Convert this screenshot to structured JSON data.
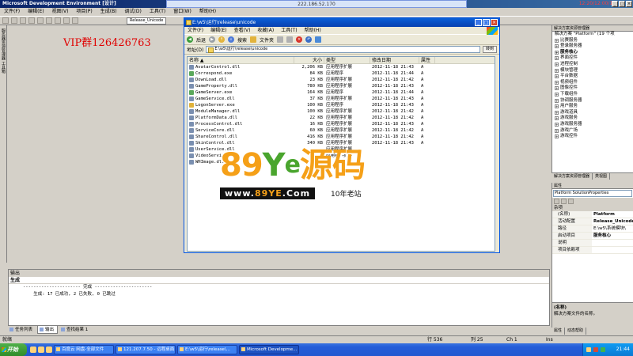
{
  "vs": {
    "title": "Microsoft Development Environment [设计]",
    "remote_ip": "222.186.52.170",
    "clock_top": "12:20/12:00/11",
    "menu": [
      "文件(F)",
      "编辑(E)",
      "视图(V)",
      "项目(P)",
      "生成(B)",
      "调试(D)",
      "工具(T)",
      "窗口(W)",
      "帮助(H)"
    ],
    "toolbar_combo": "Release_Unicode",
    "left_strip_label": "服务器资源管理器 工具箱"
  },
  "overlay_text": "VIP群126426763",
  "explorer": {
    "title": "E:\\w5\\运行\\release\\unicode",
    "menu": [
      "文件(F)",
      "编辑(E)",
      "查看(V)",
      "收藏(A)",
      "工具(T)",
      "帮助(H)"
    ],
    "tools": {
      "back": "后退",
      "search": "搜索",
      "folders": "文件夹"
    },
    "address_label": "地址(D)",
    "address_value": "E:\\w5\\运行\\release\\unicode",
    "go_label": "转到",
    "columns": [
      "名称 ▲",
      "大小",
      "类型",
      "修改日期",
      "属性"
    ],
    "files": [
      {
        "name": "AvatarControl.dll",
        "size": "2,206 KB",
        "type": "应用程序扩展",
        "date": "2012-11-18 21:43",
        "attr": "A",
        "icon": "dll"
      },
      {
        "name": "Correspond.exe",
        "size": "84 KB",
        "type": "应用程序",
        "date": "2012-11-18 21:44",
        "attr": "A",
        "icon": "exe"
      },
      {
        "name": "DownLoad.dll",
        "size": "23 KB",
        "type": "应用程序扩展",
        "date": "2012-11-18 21:42",
        "attr": "A",
        "icon": "dll"
      },
      {
        "name": "GameProperty.dll",
        "size": "780 KB",
        "type": "应用程序扩展",
        "date": "2012-11-18 21:43",
        "attr": "A",
        "icon": "dll"
      },
      {
        "name": "GameServer.exe",
        "size": "164 KB",
        "type": "应用程序",
        "date": "2012-11-18 21:44",
        "attr": "A",
        "icon": "exe"
      },
      {
        "name": "GameService.dll",
        "size": "37 KB",
        "type": "应用程序扩展",
        "date": "2012-11-18 21:43",
        "attr": "A",
        "icon": "dll"
      },
      {
        "name": "LogonServer.exe",
        "size": "100 KB",
        "type": "应用程序",
        "date": "2012-11-18 21:43",
        "attr": "A",
        "icon": "key"
      },
      {
        "name": "ModuleManager.dll",
        "size": "100 KB",
        "type": "应用程序扩展",
        "date": "2012-11-18 21:42",
        "attr": "A",
        "icon": "dll"
      },
      {
        "name": "PlatformData.dll",
        "size": "22 KB",
        "type": "应用程序扩展",
        "date": "2012-11-18 21:42",
        "attr": "A",
        "icon": "dll"
      },
      {
        "name": "ProcessControl.dll",
        "size": "16 KB",
        "type": "应用程序扩展",
        "date": "2012-11-18 21:43",
        "attr": "A",
        "icon": "dll"
      },
      {
        "name": "ServiceCore.dll",
        "size": "60 KB",
        "type": "应用程序扩展",
        "date": "2012-11-18 21:42",
        "attr": "A",
        "icon": "dll"
      },
      {
        "name": "ShareControl.dll",
        "size": "416 KB",
        "type": "应用程序扩展",
        "date": "2012-11-18 21:42",
        "attr": "A",
        "icon": "dll"
      },
      {
        "name": "SkinControl.dll",
        "size": "340 KB",
        "type": "应用程序扩展",
        "date": "2012-11-18 21:43",
        "attr": "A",
        "icon": "dll"
      },
      {
        "name": "UserService.dll",
        "size": "",
        "type": "应用程序扩展",
        "date": "",
        "attr": "",
        "icon": "dll"
      },
      {
        "name": "VideoServi...",
        "size": "",
        "type": "应用程序扩展",
        "date": "",
        "attr": "",
        "icon": "dll"
      },
      {
        "name": "WHImage.dl...",
        "size": "",
        "type": "",
        "date": "",
        "attr": "",
        "icon": "dll"
      }
    ]
  },
  "solution": {
    "header": "解决方案资源管理器",
    "root": "解决方案 \"Platform\" (19 个项",
    "items": [
      "比赛服务",
      "登录服务器",
      "服务核心",
      "界面控件",
      "进程控制",
      "模块管理",
      "平台数据",
      "视频组件",
      "图像控件",
      "下载组件",
      "协调服务器",
      "用户服务",
      "游戏道具",
      "游戏服务",
      "游戏服务器",
      "游戏广场",
      "游戏控件"
    ],
    "bold_item": "服务核心",
    "tabs": [
      "解决方案资源管理器",
      "类视图"
    ]
  },
  "properties": {
    "header": "属性",
    "combo": "Platform SolutionProperties",
    "category": "杂项",
    "rows": [
      {
        "k": "(名称)",
        "v": "Platform"
      },
      {
        "k": "活动配置",
        "v": "Release_Unicode"
      },
      {
        "k": "路径",
        "v": "E:\\w5\\系统模块\\"
      },
      {
        "k": "启动项目",
        "v": "服务核心"
      },
      {
        "k": "说明",
        "v": ""
      },
      {
        "k": "项目依赖项",
        "v": ""
      }
    ],
    "desc_title": "(名称)",
    "desc_text": "解决方案文件的名称。",
    "tabs": [
      "属性",
      "动态帮助"
    ]
  },
  "output": {
    "title": "输出",
    "head": "生成",
    "lines": [
      "---------------------- 完成 ----------------------",
      "",
      "    生成: 17 已成功, 2 已失败, 0 已跳过"
    ],
    "tabs": [
      "任务列表",
      "输出",
      "查找结果 1"
    ]
  },
  "status": {
    "left": "就绪",
    "ln": "行 536",
    "col": "列 25",
    "ch": "Ch 1",
    "ins": "Ins"
  },
  "taskbar": {
    "start": "开始",
    "tasks": [
      "百度云 网盘-全部文件",
      "121.207.7.50 - 远程桌面",
      "E:\\w5\\运行\\release\\...",
      "Microsoft Developme..."
    ],
    "clock": "21:44"
  },
  "watermark": {
    "digits": "89",
    "ye": "Y",
    "e": "e",
    "cn": "源码",
    "url_pre": "www.",
    "url_hi": "89YE",
    "url_post": ".Com",
    "tag": "10年老站"
  }
}
